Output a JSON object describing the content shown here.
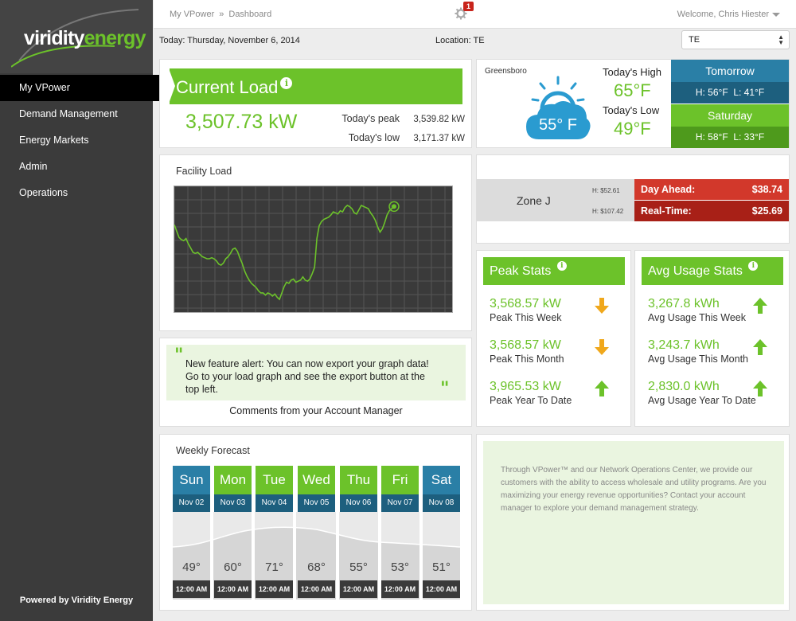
{
  "brand": {
    "logo_a": "viridity",
    "logo_b": "energy",
    "powered_by": "Powered by Viridity Energy"
  },
  "nav": {
    "items": [
      "My VPower",
      "Demand Management",
      "Energy Markets",
      "Admin",
      "Operations"
    ],
    "active": "My VPower"
  },
  "header": {
    "breadcrumb": [
      "My VPower",
      "Dashboard"
    ],
    "notification_count": "1",
    "welcome": "Welcome, Chris Hiester"
  },
  "info": {
    "today": "Today: Thursday, November 6, 2014",
    "location": "Location: TE",
    "select_value": "TE"
  },
  "current_load": {
    "title": "Current Load",
    "value": "3,507.73 kW",
    "peak_label": "Today's peak",
    "peak_value": "3,539.82 kW",
    "low_label": "Today's low",
    "low_value": "3,171.37 kW"
  },
  "weather": {
    "city": "Greensboro",
    "current_temp": "55° F",
    "high_label": "Today's High",
    "high": "65°F",
    "low_label": "Today's Low",
    "low": "49°F",
    "forecast": [
      {
        "day": "Tomorrow",
        "high": "H: 56°F",
        "low": "L: 41°F",
        "day_color": "#2a7fa6",
        "hl_color": "#1d5f7e"
      },
      {
        "day": "Saturday",
        "high": "H: 58°F",
        "low": "L: 33°F",
        "day_color": "#6cc22a",
        "hl_color": "#4e9a1c"
      }
    ]
  },
  "facility_load": {
    "title": "Facility Load"
  },
  "chart_data": {
    "type": "line",
    "title": "Facility Load",
    "xlabel": "",
    "ylabel": "",
    "grid": true,
    "series": [
      {
        "values": [
          0.76,
          0.7,
          0.64,
          0.62,
          0.61,
          0.63,
          0.58,
          0.54,
          0.5,
          0.49,
          0.5,
          0.48,
          0.46,
          0.45,
          0.44,
          0.44,
          0.45,
          0.44,
          0.42,
          0.39,
          0.38,
          0.4,
          0.44,
          0.46,
          0.49,
          0.53,
          0.54,
          0.51,
          0.45,
          0.4,
          0.33,
          0.28,
          0.24,
          0.21,
          0.19,
          0.17,
          0.14,
          0.12,
          0.12,
          0.1,
          0.12,
          0.11,
          0.09,
          0.11,
          0.08,
          0.06,
          0.12,
          0.18,
          0.22,
          0.21,
          0.24,
          0.25,
          0.22,
          0.23,
          0.24,
          0.27,
          0.24,
          0.23,
          0.25,
          0.3,
          0.36,
          0.63,
          0.75,
          0.79,
          0.81,
          0.82,
          0.83,
          0.85,
          0.88,
          0.87,
          0.86,
          0.89,
          0.88,
          0.92,
          0.94,
          0.93,
          0.91,
          0.87,
          0.86,
          0.9,
          0.94,
          0.93,
          0.92,
          0.91,
          0.87,
          0.84,
          0.8,
          0.74,
          0.69,
          0.72,
          0.78,
          0.85,
          0.89,
          0.91,
          0.93
        ]
      }
    ]
  },
  "zone": {
    "name": "Zone J",
    "h_day_ahead": "H: $52.61",
    "h_real_time": "H: $107.42",
    "day_ahead_label": "Day Ahead:",
    "day_ahead_value": "$38.74",
    "real_time_label": "Real-Time:",
    "real_time_value": "$25.69"
  },
  "peak_stats": {
    "title": "Peak Stats",
    "items": [
      {
        "value": "3,568.57 kW",
        "label": "Peak This Week",
        "trend": "down"
      },
      {
        "value": "3,568.57 kW",
        "label": "Peak This Month",
        "trend": "down"
      },
      {
        "value": "3,965.53 kW",
        "label": "Peak Year To Date",
        "trend": "up"
      }
    ]
  },
  "avg_stats": {
    "title": "Avg Usage Stats",
    "items": [
      {
        "value": "3,267.8 kWh",
        "label": "Avg Usage This Week",
        "trend": "up"
      },
      {
        "value": "3,243.7 kWh",
        "label": "Avg Usage This Month",
        "trend": "up"
      },
      {
        "value": "2,830.0 kWh",
        "label": "Avg Usage Year To Date",
        "trend": "up"
      }
    ]
  },
  "alert": {
    "text": "New feature alert: You can now export your graph data! Go to your load graph and see the export button at the top left.",
    "from": "Comments from your Account Manager"
  },
  "weekly_forecast": {
    "title": "Weekly Forecast",
    "days": [
      {
        "name": "Sun",
        "date": "Nov 02",
        "temp": "49°",
        "time": "12:00 AM",
        "color": "#2a7fa6",
        "dcolor": "#1d5f7e"
      },
      {
        "name": "Mon",
        "date": "Nov 03",
        "temp": "60°",
        "time": "12:00 AM",
        "color": "#6cc22a",
        "dcolor": "#1d5f7e"
      },
      {
        "name": "Tue",
        "date": "Nov 04",
        "temp": "71°",
        "time": "12:00 AM",
        "color": "#6cc22a",
        "dcolor": "#1d5f7e"
      },
      {
        "name": "Wed",
        "date": "Nov 05",
        "temp": "68°",
        "time": "12:00 AM",
        "color": "#6cc22a",
        "dcolor": "#1d5f7e"
      },
      {
        "name": "Thu",
        "date": "Nov 06",
        "temp": "55°",
        "time": "12:00 AM",
        "color": "#6cc22a",
        "dcolor": "#1d5f7e"
      },
      {
        "name": "Fri",
        "date": "Nov 07",
        "temp": "53°",
        "time": "12:00 AM",
        "color": "#6cc22a",
        "dcolor": "#1d5f7e"
      },
      {
        "name": "Sat",
        "date": "Nov 08",
        "temp": "51°",
        "time": "12:00 AM",
        "color": "#2a7fa6",
        "dcolor": "#1d5f7e"
      }
    ]
  },
  "promo": {
    "text": "Through VPower™ and our Network Operations Center, we provide our customers with the ability to access wholesale and utility programs. Are you maximizing your energy revenue opportunities? Contact your account manager to explore your demand management strategy."
  },
  "colors": {
    "green": "#6cc22a",
    "blue": "#2a7fa6",
    "red": "#d2382b",
    "dark_red": "#a82017",
    "orange": "#f0a81c"
  }
}
